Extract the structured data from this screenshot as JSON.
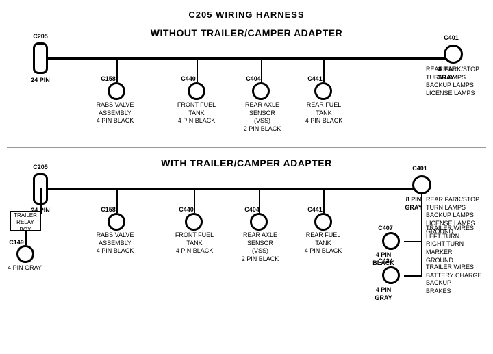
{
  "title": "C205 WIRING HARNESS",
  "section1": {
    "label": "WITHOUT  TRAILER/CAMPER  ADAPTER",
    "left_connector": {
      "id": "C205",
      "pin": "24 PIN"
    },
    "right_connector": {
      "id": "C401",
      "pin": "8 PIN",
      "color": "GRAY",
      "desc": "REAR PARK/STOP\nTURN LAMPS\nBACKUP LAMPS\nLICENSE LAMPS"
    },
    "connectors": [
      {
        "id": "C158",
        "desc": "RABS VALVE\nASSEMBLY\n4 PIN BLACK"
      },
      {
        "id": "C440",
        "desc": "FRONT FUEL\nTANK\n4 PIN BLACK"
      },
      {
        "id": "C404",
        "desc": "REAR AXLE\nSENSOR\n(VSS)\n2 PIN BLACK"
      },
      {
        "id": "C441",
        "desc": "REAR FUEL\nTANK\n4 PIN BLACK"
      }
    ]
  },
  "section2": {
    "label": "WITH  TRAILER/CAMPER  ADAPTER",
    "left_connector": {
      "id": "C205",
      "pin": "24 PIN"
    },
    "right_connector": {
      "id": "C401",
      "pin": "8 PIN",
      "color": "GRAY",
      "desc": "REAR PARK/STOP\nTURN LAMPS\nBACKUP LAMPS\nLICENSE LAMPS\nGROUND"
    },
    "extra_left": {
      "box_label": "TRAILER\nRELAY\nBOX",
      "conn_id": "C149",
      "conn_desc": "4 PIN GRAY"
    },
    "connectors": [
      {
        "id": "C158",
        "desc": "RABS VALVE\nASSEMBLY\n4 PIN BLACK"
      },
      {
        "id": "C440",
        "desc": "FRONT FUEL\nTANK\n4 PIN BLACK"
      },
      {
        "id": "C404",
        "desc": "REAR AXLE\nSENSOR\n(VSS)\n2 PIN BLACK"
      },
      {
        "id": "C441",
        "desc": "REAR FUEL\nTANK\n4 PIN BLACK"
      }
    ],
    "right_extra": [
      {
        "conn_id": "C407",
        "conn_desc": "4 PIN\nBLACK",
        "wire_desc": "TRAILER WIRES\nLEFT TURN\nRIGHT TURN\nMARKER\nGROUND"
      },
      {
        "conn_id": "C424",
        "conn_desc": "4 PIN\nGRAY",
        "wire_desc": "TRAILER WIRES\nBATTERY CHARGE\nBACKUP\nBRAKES"
      }
    ]
  }
}
